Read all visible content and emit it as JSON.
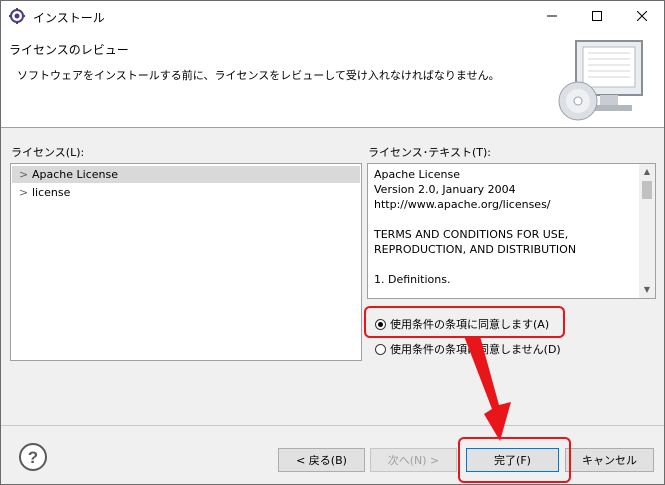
{
  "window": {
    "title": "インストール"
  },
  "banner": {
    "title": "ライセンスのレビュー",
    "description": "ソフトウェアをインストールする前に、ライセンスをレビューして受け入れなければなりません。"
  },
  "licenses": {
    "label": "ライセンス(L):",
    "items": [
      {
        "label": "Apache License",
        "selected": true
      },
      {
        "label": "license",
        "selected": false
      }
    ]
  },
  "license_text": {
    "label": "ライセンス･テキスト(T):",
    "lines": [
      "Apache License",
      "Version 2.0, January 2004",
      "http://www.apache.org/licenses/",
      "",
      "TERMS AND CONDITIONS FOR USE,",
      "REPRODUCTION, AND DISTRIBUTION",
      "",
      "1. Definitions."
    ]
  },
  "radios": {
    "accept": {
      "label": "使用条件の条項に同意します(A)",
      "checked": true
    },
    "decline": {
      "label": "使用条件の条項に同意しません(D)",
      "checked": false
    }
  },
  "buttons": {
    "back": "< 戻る(B)",
    "next": "次へ(N) >",
    "finish": "完了(F)",
    "cancel": "キャンセル"
  },
  "colors": {
    "highlight": "#e8161b",
    "window_bg": "#f0f0f0"
  },
  "icons": {
    "app": "eclipse-gear-icon",
    "minimize": "minimize-icon",
    "maximize": "maximize-icon",
    "close": "close-icon",
    "help": "help-icon",
    "banner": "monitor-cd-icon"
  }
}
